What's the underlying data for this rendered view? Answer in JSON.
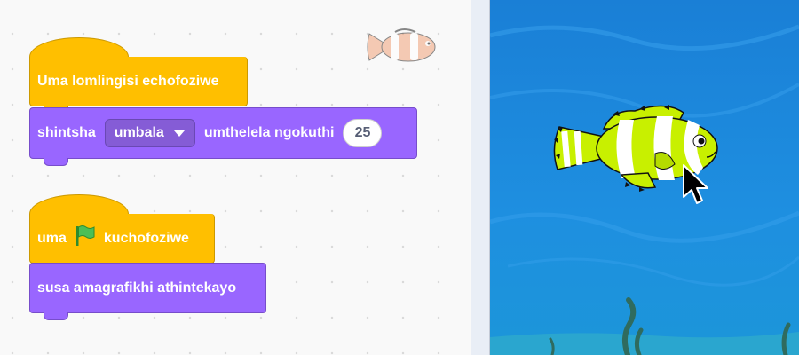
{
  "blocks": {
    "when_backdrop_switches": {
      "label": "Uma lomlingisi echofoziwe"
    },
    "change_effect": {
      "prefix": "shintsha",
      "effect_option": "umbala",
      "middle": "umthelela ngokuthi",
      "value": "25"
    },
    "when_flag_clicked": {
      "prefix": "uma",
      "suffix": "kuchofoziwe",
      "icon": "green-flag-icon"
    },
    "clear_graphic_effects": {
      "label": "susa amagrafikhi athintekayo"
    }
  },
  "sprite_thumbnail": {
    "icon": "clownfish-icon"
  },
  "stage": {
    "background_color": "#1e8fe0",
    "sprite": "clownfish",
    "cursor": "arrow-cursor-icon"
  },
  "colors": {
    "events": "#ffbf00",
    "looks": "#9966ff",
    "fish_body": "#c8f000"
  }
}
